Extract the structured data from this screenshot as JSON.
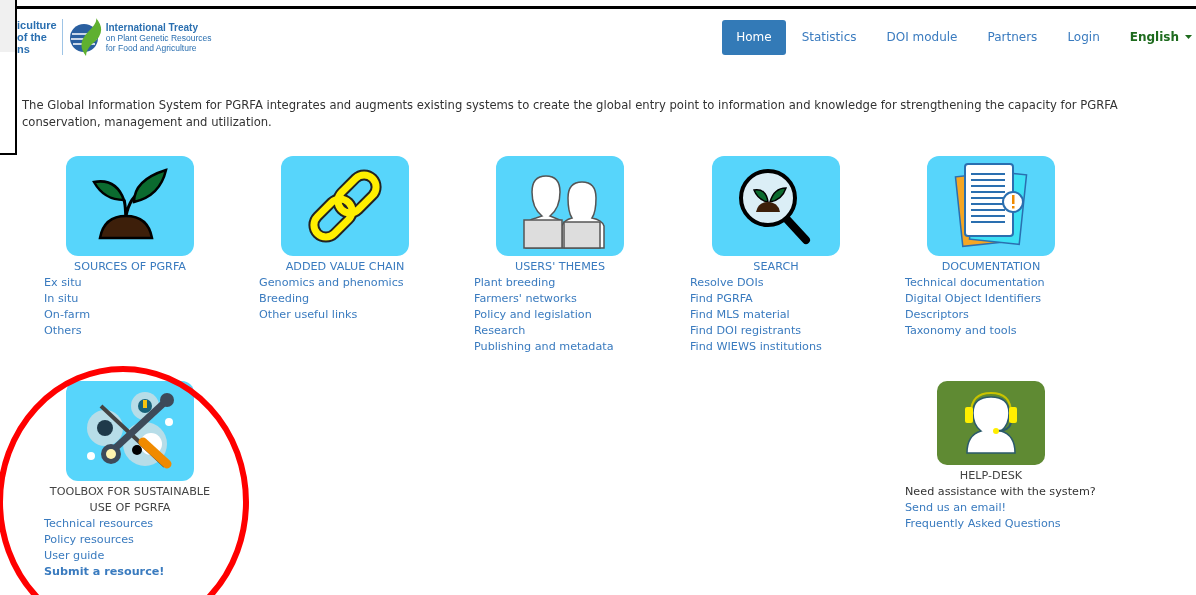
{
  "logo": {
    "org_lines": [
      "iculture",
      "of the",
      "ns"
    ],
    "treaty_title": "International Treaty",
    "treaty_lines": [
      "on Plant Genetic Resources",
      "for Food and Agriculture"
    ]
  },
  "nav": [
    {
      "label": "Home",
      "selected": true
    },
    {
      "label": "Statistics",
      "selected": false
    },
    {
      "label": "DOI module",
      "selected": false
    },
    {
      "label": "Partners",
      "selected": false
    },
    {
      "label": "Login",
      "selected": false
    }
  ],
  "language": {
    "label": "English"
  },
  "intro": "The Global Information System for PGRFA integrates and augments existing systems to create the global entry point to information and knowledge for strengthening the capacity for PGRFA conservation, management and utilization.",
  "rows": [
    {
      "sections": [
        {
          "kind": "plant",
          "title": "SOURCES OF PGRFA",
          "title_link": true,
          "links": [
            {
              "label": "Ex situ",
              "bold": false
            },
            {
              "label": "In situ",
              "bold": false
            },
            {
              "label": "On-farm",
              "bold": false
            },
            {
              "label": "Others",
              "bold": false
            }
          ]
        },
        {
          "kind": "chain",
          "title": "ADDED VALUE CHAIN",
          "title_link": true,
          "links": [
            {
              "label": "Genomics and phenomics",
              "bold": false
            },
            {
              "label": "Breeding",
              "bold": false
            },
            {
              "label": "Other useful links",
              "bold": false
            }
          ]
        },
        {
          "kind": "users",
          "title": "USERS' THEMES",
          "title_link": true,
          "links": [
            {
              "label": "Plant breeding",
              "bold": false
            },
            {
              "label": "Farmers' networks",
              "bold": false
            },
            {
              "label": "Policy and legislation",
              "bold": false
            },
            {
              "label": "Research",
              "bold": false
            },
            {
              "label": "Publishing and metadata",
              "bold": false
            }
          ]
        },
        {
          "kind": "search",
          "title": "SEARCH",
          "title_link": true,
          "links": [
            {
              "label": "Resolve DOIs",
              "bold": false
            },
            {
              "label": "Find PGRFA",
              "bold": false
            },
            {
              "label": "Find MLS material",
              "bold": false
            },
            {
              "label": "Find DOI registrants",
              "bold": false
            },
            {
              "label": "Find WIEWS institutions",
              "bold": false
            }
          ]
        },
        {
          "kind": "documents",
          "title": "DOCUMENTATION",
          "title_link": true,
          "links": [
            {
              "label": "Technical documentation",
              "bold": false
            },
            {
              "label": "Digital Object Identifiers",
              "bold": false
            },
            {
              "label": "Descriptors",
              "bold": false
            },
            {
              "label": "Taxonomy and tools",
              "bold": false
            }
          ]
        }
      ]
    },
    {
      "sections": [
        {
          "kind": "tools",
          "title": "TOOLBOX FOR SUSTAINABLE USE OF PGRFA",
          "title_link": false,
          "links": [
            {
              "label": "Technical resources",
              "bold": false
            },
            {
              "label": "Policy resources",
              "bold": false
            },
            {
              "label": "User guide",
              "bold": false
            },
            {
              "label": "Submit a resource!",
              "bold": true
            }
          ]
        },
        {
          "kind": "helpdesk",
          "title": "HELP-DESK",
          "title_link": false,
          "description": "Need assistance with the system?",
          "links": [
            {
              "label": "Send us an email!",
              "bold": false
            },
            {
              "label": "Frequently Asked Questions",
              "bold": false
            }
          ]
        }
      ]
    }
  ]
}
